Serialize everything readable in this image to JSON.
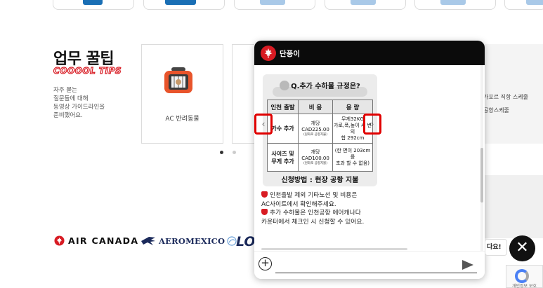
{
  "tips": {
    "title": "업무 꿀팁",
    "subtitle": "COOOOL TIPS",
    "description": [
      "자주 묻는",
      "질문들에 대해",
      "동영상 가이드라인을",
      "준비했어요."
    ],
    "cards": [
      {
        "label": "AC 반려동물"
      }
    ],
    "pagination": {
      "count": 2,
      "active": 1
    }
  },
  "peek": {
    "lines": [
      "가포르 직항 스케줄",
      "공항스케줄"
    ],
    "bubble": "다요!",
    "recaptcha": "개인정보 보호"
  },
  "brands": {
    "aircanada": "AIR CANADA",
    "aeromexico": "AEROMEXICO",
    "lot": "LOT"
  },
  "chat": {
    "title": "단풍이",
    "card": {
      "question": "Q.추가 수하물 규정은?",
      "headers": [
        "인천 출발",
        "비 용",
        "용 량"
      ],
      "rows": [
        {
          "label": "가수 추가",
          "fee_prefix": "개당",
          "fee": "CAD225.00",
          "fee_note": "(원화로 공항지불)",
          "cap1": "무게32KG",
          "cap2": "가로,폭,높이 세 변의",
          "cap3": "합 292cm"
        },
        {
          "label1": "사이즈 및",
          "label2": "무게 추가",
          "fee_prefix": "개당",
          "fee": "CAD100.00",
          "fee_note": "(원화로 공항지불)",
          "cap1": "(한 면이 203cm를",
          "cap2": "초과 할 수 없음)"
        }
      ],
      "footer": "신청방법 : 현장 공항 지불"
    },
    "message": [
      "인천출발 제외 기타노선 및 비용은",
      "AC사이트에서 확인해주세요.",
      "추가 수하물은 인천공항 에어캐나다",
      "카운터에서 체크인 시 신청할 수 있어요."
    ],
    "input": {
      "placeholder": ""
    }
  },
  "colors": {
    "accent": "#d81b23",
    "dark": "#0b0b0b",
    "nav_highlight": "#e00000",
    "blue": "#1a6fb5"
  }
}
